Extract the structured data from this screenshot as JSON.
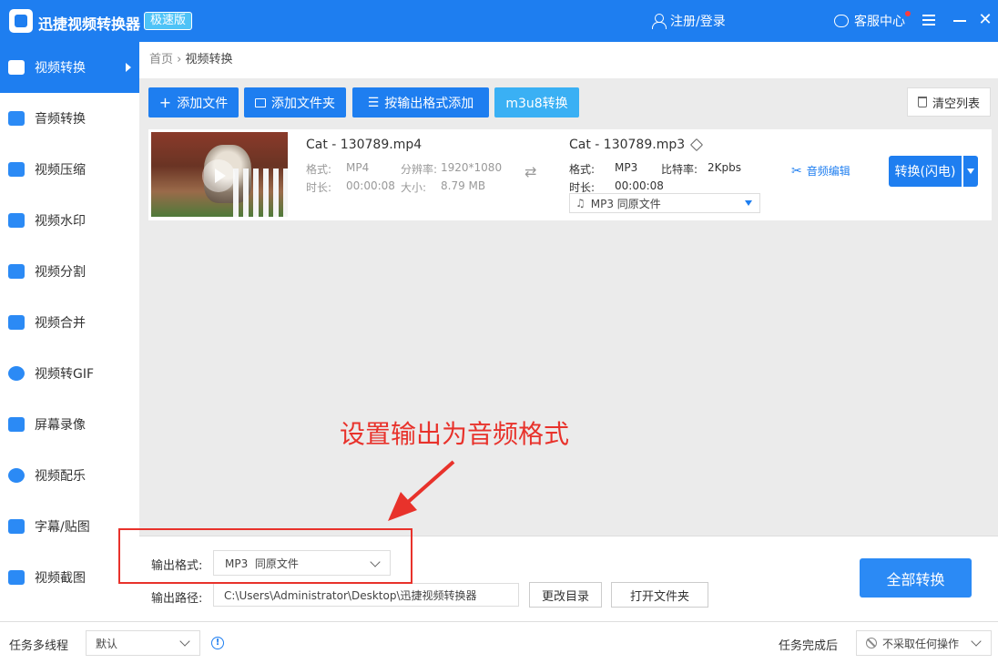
{
  "titlebar": {
    "app_title": "迅捷视频转换器",
    "edition": "极速版",
    "login": "注册/登录",
    "support": "客服中心"
  },
  "sidebar": {
    "items": [
      {
        "label": "视频转换",
        "icon": "video-convert-icon",
        "active": true
      },
      {
        "label": "音频转换",
        "icon": "audio-convert-icon"
      },
      {
        "label": "视频压缩",
        "icon": "video-compress-icon"
      },
      {
        "label": "视频水印",
        "icon": "video-watermark-icon"
      },
      {
        "label": "视频分割",
        "icon": "video-split-icon"
      },
      {
        "label": "视频合并",
        "icon": "video-merge-icon"
      },
      {
        "label": "视频转GIF",
        "icon": "gif-icon"
      },
      {
        "label": "屏幕录像",
        "icon": "screen-record-icon"
      },
      {
        "label": "视频配乐",
        "icon": "music-icon"
      },
      {
        "label": "字幕/贴图",
        "icon": "subtitle-icon"
      },
      {
        "label": "视频截图",
        "icon": "screenshot-icon"
      }
    ]
  },
  "breadcrumb": {
    "home": "首页",
    "sep": "›",
    "current": "视频转换"
  },
  "toolbar": {
    "add_file": "添加文件",
    "add_folder": "添加文件夹",
    "add_by_format": "按输出格式添加",
    "m3u8": "m3u8转换",
    "clear_list": "清空列表"
  },
  "file": {
    "src_name": "Cat - 130789.mp4",
    "format_label": "格式:",
    "format": "MP4",
    "resolution_label": "分辨率:",
    "resolution": "1920*1080",
    "duration_label": "时长:",
    "duration": "00:00:08",
    "size_label": "大小:",
    "size": "8.79 MB",
    "out_name": "Cat - 130789.mp3",
    "out_format_label": "格式:",
    "out_format": "MP3",
    "bitrate_label": "比特率:",
    "bitrate": "2Kpbs",
    "out_duration_label": "时长:",
    "out_duration": "00:00:08",
    "out_select": "MP3 同原文件",
    "audio_edit": "音频编辑",
    "convert": "转换(闪电)"
  },
  "annotation": {
    "text": "设置输出为音频格式",
    "color": "#e8322b"
  },
  "output": {
    "format_label": "输出格式:",
    "format_value": "MP3  同原文件",
    "path_label": "输出路径:",
    "path_value": "C:\\Users\\Administrator\\Desktop\\迅捷视频转换器",
    "change_dir": "更改目录",
    "open_folder": "打开文件夹",
    "convert_all": "全部转换"
  },
  "statusbar": {
    "threads_label": "任务多线程",
    "threads_value": "默认",
    "after_label": "任务完成后",
    "after_value": "不采取任何操作"
  },
  "colors": {
    "primary": "#1e7ef0",
    "accent": "#3ab0f4",
    "annotation": "#e8322b"
  }
}
